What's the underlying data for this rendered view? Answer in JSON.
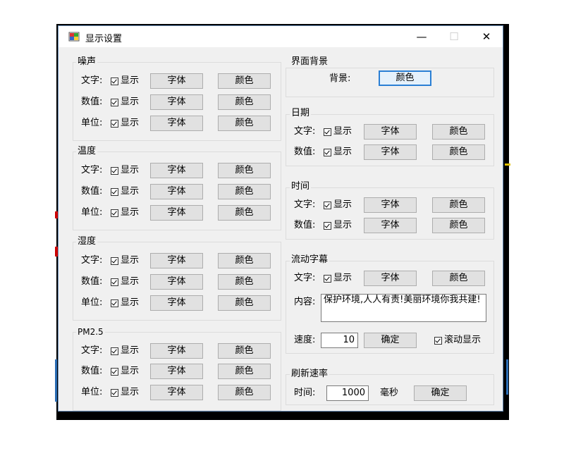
{
  "window": {
    "title": "显示设置",
    "minimize_glyph": "—",
    "maximize_glyph": "☐",
    "close_glyph": "✕"
  },
  "labels": {
    "text": "文字:",
    "value": "数值:",
    "unit": "单位:",
    "show": "显示",
    "font": "字体",
    "color": "颜色"
  },
  "noise": {
    "title": "噪声"
  },
  "temperature": {
    "title": "温度"
  },
  "humidity": {
    "title": "湿度"
  },
  "pm25": {
    "title": "PM2.5"
  },
  "background": {
    "title": "界面背景",
    "label": "背景:",
    "button": "颜色"
  },
  "date": {
    "title": "日期"
  },
  "time_group": {
    "title": "时间"
  },
  "marquee": {
    "title": "流动字幕",
    "content_label": "内容:",
    "content": "保护环境,人人有责!美丽环境你我共建!",
    "speed_label": "速度:",
    "speed": "10",
    "confirm": "确定",
    "scroll_label": "滚动显示"
  },
  "refresh": {
    "title": "刷新速率",
    "time_label": "时间:",
    "time_value": "1000",
    "unit": "毫秒",
    "confirm": "确定"
  },
  "checkboxes_checked": true,
  "colors": {
    "focus_border": "#2a7fd4",
    "window_bg": "#f0f0f0"
  }
}
